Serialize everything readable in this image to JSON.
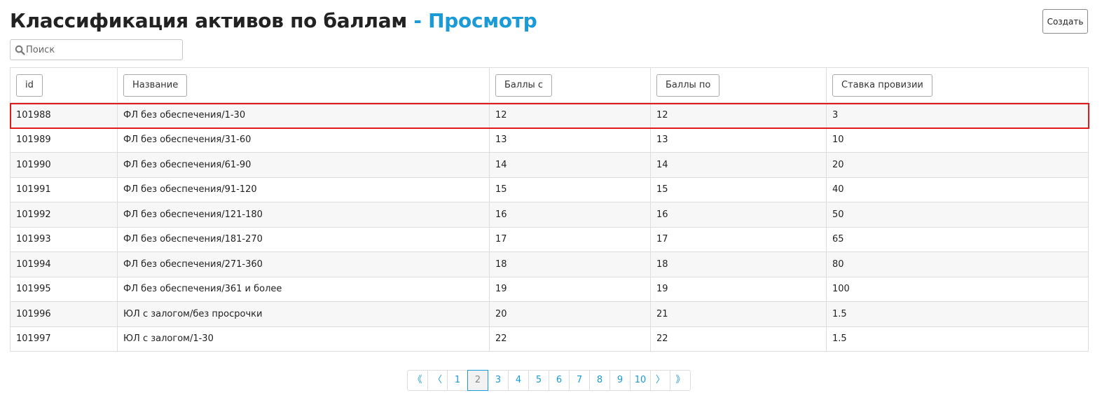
{
  "header": {
    "title_main": "Классификация активов по баллам",
    "title_accent": "- Просмотр",
    "create_label": "Создать"
  },
  "search": {
    "placeholder": "Поиск",
    "value": ""
  },
  "table": {
    "columns": [
      "id",
      "Название",
      "Баллы с",
      "Баллы по",
      "Ставка провизии"
    ],
    "rows": [
      [
        "101988",
        "ФЛ без обеспечения/1-30",
        "12",
        "12",
        "3"
      ],
      [
        "101989",
        "ФЛ без обеспечения/31-60",
        "13",
        "13",
        "10"
      ],
      [
        "101990",
        "ФЛ без обеспечения/61-90",
        "14",
        "14",
        "20"
      ],
      [
        "101991",
        "ФЛ без обеспечения/91-120",
        "15",
        "15",
        "40"
      ],
      [
        "101992",
        "ФЛ без обеспечения/121-180",
        "16",
        "16",
        "50"
      ],
      [
        "101993",
        "ФЛ без обеспечения/181-270",
        "17",
        "17",
        "65"
      ],
      [
        "101994",
        "ФЛ без обеспечения/271-360",
        "18",
        "18",
        "80"
      ],
      [
        "101995",
        "ФЛ без обеспечения/361 и более",
        "19",
        "19",
        "100"
      ],
      [
        "101996",
        "ЮЛ с залогом/без просрочки",
        "20",
        "21",
        "1.5"
      ],
      [
        "101997",
        "ЮЛ с залогом/1-30",
        "22",
        "22",
        "1.5"
      ]
    ],
    "highlighted_row": 0
  },
  "pagination": {
    "first": "《",
    "prev": "〈",
    "pages": [
      "1",
      "2",
      "3",
      "4",
      "5",
      "6",
      "7",
      "8",
      "9",
      "10"
    ],
    "current": "2",
    "next": "〉",
    "last": "》"
  },
  "colors": {
    "accent": "#1a9ad6",
    "highlight": "#e0191b"
  },
  "icons": {
    "search": "search-icon"
  }
}
